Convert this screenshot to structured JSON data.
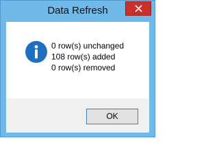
{
  "window": {
    "title": "Data Refresh",
    "close_icon": "close-icon"
  },
  "dialog": {
    "icon": "info-icon",
    "messages": [
      "0 row(s) unchanged",
      "108 row(s) added",
      "0 row(s) removed"
    ],
    "ok_label": "OK"
  },
  "colors": {
    "frame": "#70b9e8",
    "close_button": "#c9302c",
    "info_icon": "#1e6fc0",
    "button_area": "#f0f0f0"
  }
}
